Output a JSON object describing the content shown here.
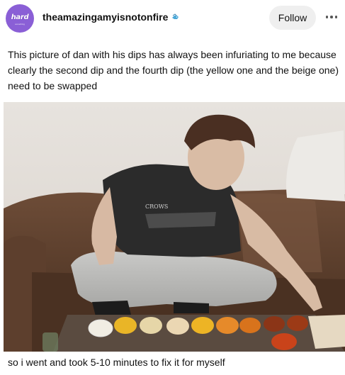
{
  "post": {
    "avatar_text": "hard",
    "avatar_subtext": "something",
    "username": "theamazingamyisnotonfire",
    "follow_label": "Follow",
    "caption": "This picture of dan with his dips has always been infuriating to me because clearly the second dip and the fourth dip (the yellow one and the beige one) need to be swapped",
    "footer": "so i went and took 5-10 minutes to fix it for myself",
    "shirt_text": "CROWS"
  },
  "colors": {
    "avatar_bg": "#8a5fd6",
    "follow_bg": "#efefef"
  },
  "icons": {
    "badge": "fish-badge-icon",
    "more": "more-dots-icon"
  }
}
